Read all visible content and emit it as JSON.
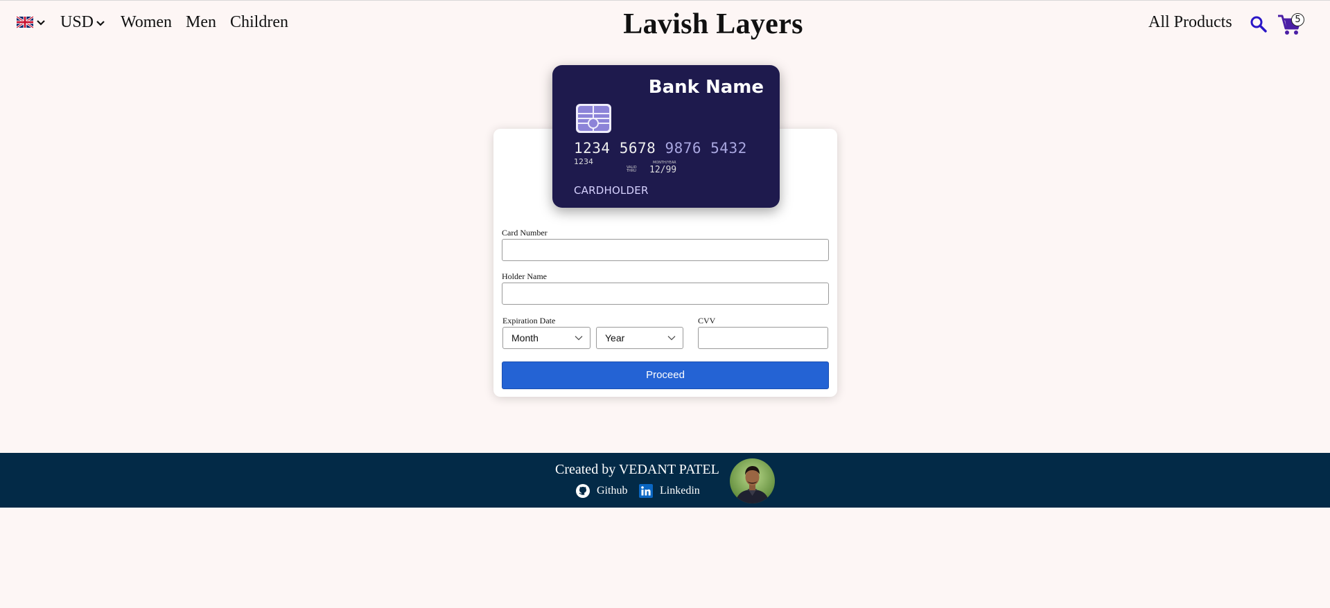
{
  "nav": {
    "currency": "USD",
    "links": [
      "Women",
      "Men",
      "Children"
    ],
    "brand": "Lavish Layers",
    "all_products": "All Products",
    "cart_count": "5"
  },
  "card": {
    "bank_name": "Bank Name",
    "number_main": "1234 5678 ",
    "number_dim": "9876 5432",
    "small_digits": "1234",
    "valid_thru": "VALID THRU",
    "month_year": "MONTH/YEAR",
    "expiry": "12/99",
    "holder": "CARDHOLDER"
  },
  "form": {
    "card_number_label": "Card Number",
    "holder_name_label": "Holder Name",
    "expiration_label": "Expiration Date",
    "cvv_label": "CVV",
    "month_value": "Month",
    "year_value": "Year",
    "proceed_label": "Proceed"
  },
  "footer": {
    "credit": "Created by VEDANT PATEL",
    "github": "Github",
    "linkedin": "Linkedin"
  },
  "colors": {
    "background": "#fdf6f5",
    "card": "#1e1a4d",
    "accent_button": "#2463d4",
    "footer": "#032a47",
    "icon_purple": "#4b1fa5"
  },
  "icons": [
    "uk-flag-icon",
    "chevron-down-icon",
    "search-icon",
    "cart-icon",
    "chip-icon",
    "github-icon",
    "linkedin-icon"
  ]
}
